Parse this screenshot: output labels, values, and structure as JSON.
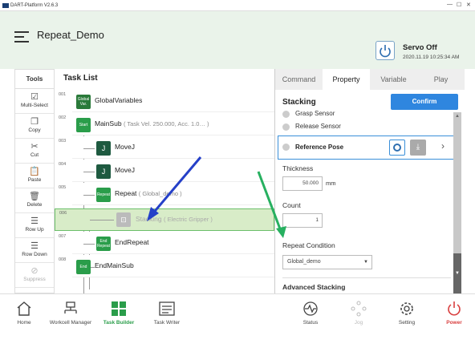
{
  "app": {
    "title": "DART-Platform V2.6.3"
  },
  "header": {
    "title": "Repeat_Demo",
    "servo_status": "Servo Off",
    "timestamp": "2020.11.19 10:25:34 AM"
  },
  "tools": {
    "heading": "Tools",
    "items": [
      {
        "label": "Multi-Select",
        "icon": "multi-select-icon",
        "enabled": true
      },
      {
        "label": "Copy",
        "icon": "copy-icon",
        "enabled": true
      },
      {
        "label": "Cut",
        "icon": "cut-icon",
        "enabled": true
      },
      {
        "label": "Paste",
        "icon": "paste-icon",
        "enabled": true
      },
      {
        "label": "Delete",
        "icon": "delete-icon",
        "enabled": true
      },
      {
        "label": "Row Up",
        "icon": "row-up-icon",
        "enabled": true
      },
      {
        "label": "Row Down",
        "icon": "row-down-icon",
        "enabled": true
      },
      {
        "label": "Suppress",
        "icon": "suppress-icon",
        "enabled": false
      }
    ]
  },
  "task_list": {
    "heading": "Task List",
    "rows": [
      {
        "num": "001",
        "icon_text": "Global Var.",
        "label": "GlobalVariables",
        "sub": ""
      },
      {
        "num": "002",
        "icon_text": "Start",
        "label": "MainSub",
        "sub": "( Task Vel. 250.000, Acc. 1.0… )"
      },
      {
        "num": "003",
        "icon_text": "J",
        "label": "MoveJ",
        "sub": ""
      },
      {
        "num": "004",
        "icon_text": "J",
        "label": "MoveJ",
        "sub": ""
      },
      {
        "num": "005",
        "icon_text": "Repeat",
        "label": "Repeat",
        "sub": "( Global_demo )"
      },
      {
        "num": "006",
        "icon_text": "",
        "label": "Stacking",
        "sub": "( Electric Gripper )"
      },
      {
        "num": "007",
        "icon_text": "End Repeat",
        "label": "EndRepeat",
        "sub": ""
      },
      {
        "num": "008",
        "icon_text": "End",
        "label": "EndMainSub",
        "sub": ""
      }
    ]
  },
  "right_panel": {
    "tabs": [
      "Command",
      "Property",
      "Variable",
      "Play"
    ],
    "active_tab": "Property",
    "section_title": "Stacking",
    "confirm_label": "Confirm",
    "options": [
      "Grasp Sensor",
      "Release Sensor"
    ],
    "reference_pose": "Reference Pose",
    "thickness_label": "Thickness",
    "thickness_value": "50.000",
    "thickness_unit": "mm",
    "count_label": "Count",
    "count_value": "1",
    "repeat_condition_label": "Repeat Condition",
    "repeat_condition_value": "Global_demo",
    "next_label": "Advanced Stacking"
  },
  "bottom_nav": [
    {
      "label": "Home",
      "enabled": true
    },
    {
      "label": "Workcell Manager",
      "enabled": true
    },
    {
      "label": "Task Builder",
      "enabled": true,
      "active": true
    },
    {
      "label": "Task Writer",
      "enabled": true
    },
    {
      "label": "Status",
      "enabled": true
    },
    {
      "label": "Jog",
      "enabled": false
    },
    {
      "label": "Setting",
      "enabled": true
    },
    {
      "label": "Power",
      "enabled": true
    }
  ],
  "colors": {
    "accent_blue": "#2f86df",
    "green": "#2a9d4a",
    "selected_row": "#d8ecc8",
    "power_red": "#d94040"
  }
}
